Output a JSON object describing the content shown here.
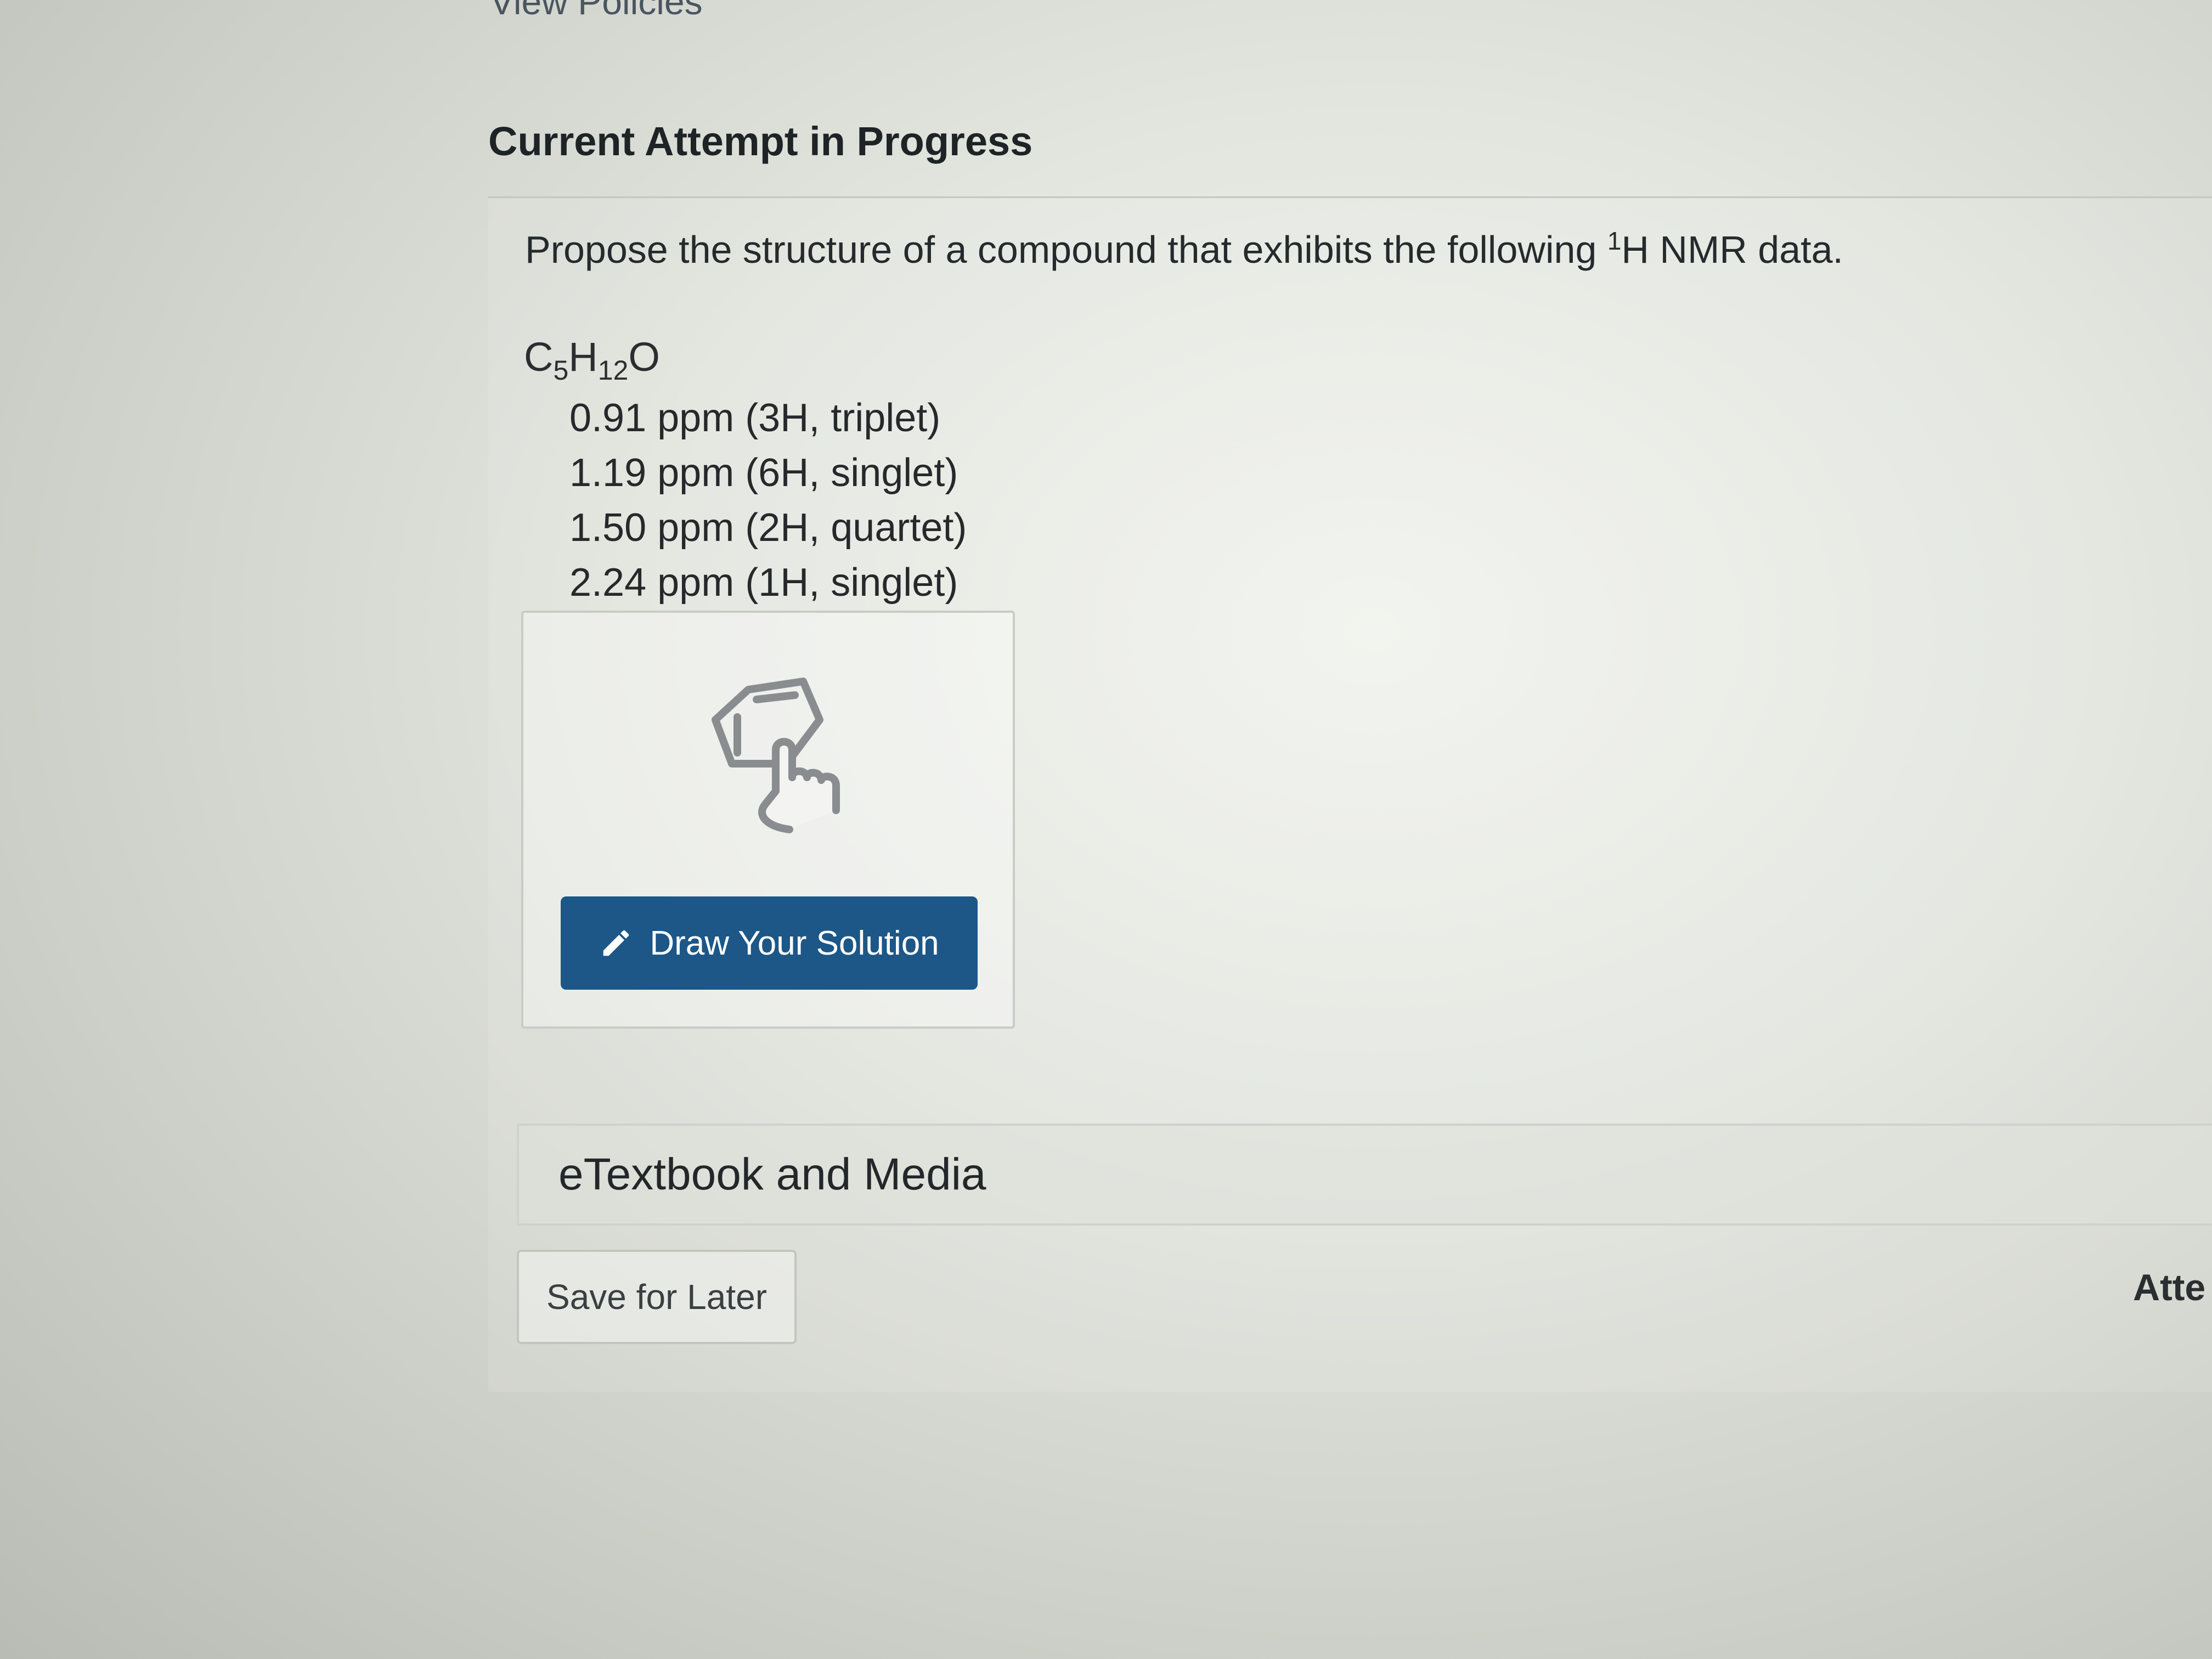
{
  "nav": {
    "view_policies": "View Policies"
  },
  "attempt": {
    "heading": "Current Attempt in Progress"
  },
  "question": {
    "prompt_before": "Propose the structure of a compound that exhibits the following ",
    "isotope_sup": "1",
    "prompt_after": "H NMR data.",
    "formula": {
      "c": "C",
      "c_count": "5",
      "h": "H",
      "h_count": "12",
      "o": "O"
    },
    "nmr_signals": [
      "0.91 ppm (3H, triplet)",
      "1.19 ppm (6H, singlet)",
      "1.50 ppm (2H, quartet)",
      "2.24 ppm (1H, singlet)"
    ]
  },
  "draw_tool": {
    "icon": "molecule-drawing-icon",
    "button_icon": "pencil-icon",
    "button_label": "Draw Your Solution"
  },
  "etextbook": {
    "label": "eTextbook and Media"
  },
  "footer": {
    "save_label": "Save for Later",
    "attempts_label": "Atte"
  },
  "colors": {
    "primary_button": "#1c5788",
    "text": "#222222"
  }
}
